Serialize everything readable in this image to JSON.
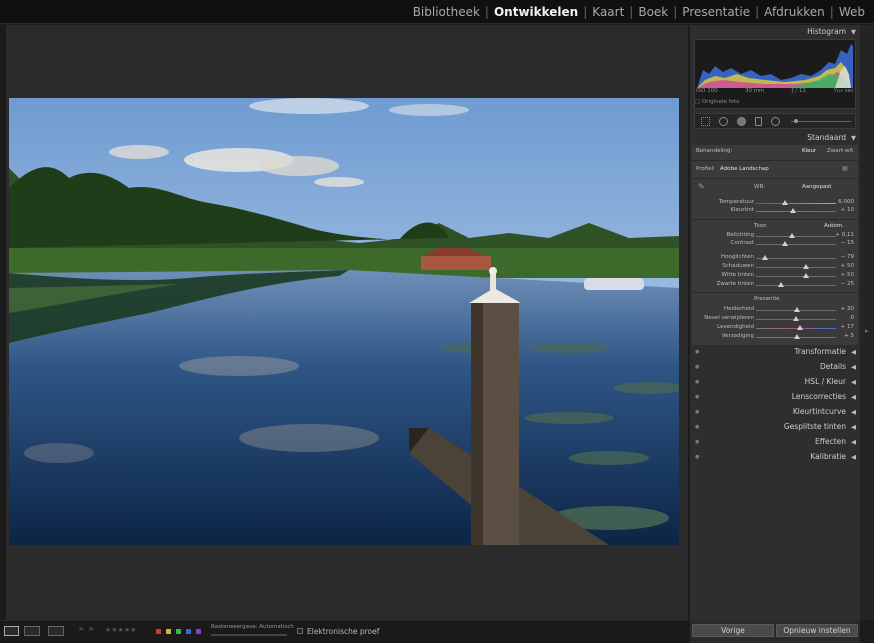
{
  "modules": [
    "Bibliotheek",
    "Ontwikkelen",
    "Kaart",
    "Boek",
    "Presentatie",
    "Afdrukken",
    "Web"
  ],
  "active_module": "Ontwikkelen",
  "panels": {
    "histogram_title": "Histogram",
    "iso": "ISO 100",
    "focal": "30 mm",
    "aperture": "ƒ / 11",
    "shutter": "¹⁄₁₂₅ sec",
    "original_photo": "Originele foto",
    "standaard": "Standaard",
    "behandeling_label": "Behandeling:",
    "kleur": "Kleur",
    "zwartwit": "Zwart-wit",
    "profiel_label": "Profiel:",
    "profiel_value": "Adobe Landschap",
    "wb_label": "WB:",
    "wb_value": "Aangepast",
    "toon": "Toon",
    "autom": "Autom.",
    "presence": "Presentie",
    "transformatie": "Transformatie",
    "details": "Details",
    "hsl": "HSL / Kleur",
    "lenscorrecties": "Lenscorrecties",
    "kleurtintcurve": "Kleurtintcurve",
    "gesplitste": "Gesplitste tinten",
    "effecten": "Effecten",
    "kalibratie": "Kalibratie"
  },
  "sliders": {
    "temperatuur": {
      "label": "Temperatuur",
      "value": "6.000"
    },
    "kleurtint": {
      "label": "Kleurtint",
      "value": "+ 10"
    },
    "belichting": {
      "label": "Belichting",
      "value": "+ 0,11"
    },
    "contrast": {
      "label": "Contrast",
      "value": "− 15"
    },
    "hooglichten": {
      "label": "Hooglichten",
      "value": "− 79"
    },
    "schaduwen": {
      "label": "Schaduwen",
      "value": "+ 50"
    },
    "wittetinten": {
      "label": "Witte tinten",
      "value": "+ 50"
    },
    "zwartetinten": {
      "label": "Zwarte tinten",
      "value": "− 25"
    },
    "helderheid": {
      "label": "Helderheid",
      "value": "+ 30"
    },
    "nevel": {
      "label": "Nevel verwijderen",
      "value": "0"
    },
    "levendigheid": {
      "label": "Levendigheid",
      "value": "+ 17"
    },
    "verzadiging": {
      "label": "Verzadiging",
      "value": "+ 5"
    }
  },
  "bottom": {
    "raster": "Rasterweergave: Automatisch",
    "softproof": "Elektronische proef",
    "vorige": "Vorige",
    "opnieuw": "Opnieuw instellen"
  },
  "colors": {
    "accent": "#f2f2f2",
    "panel": "#3a3a3a"
  }
}
